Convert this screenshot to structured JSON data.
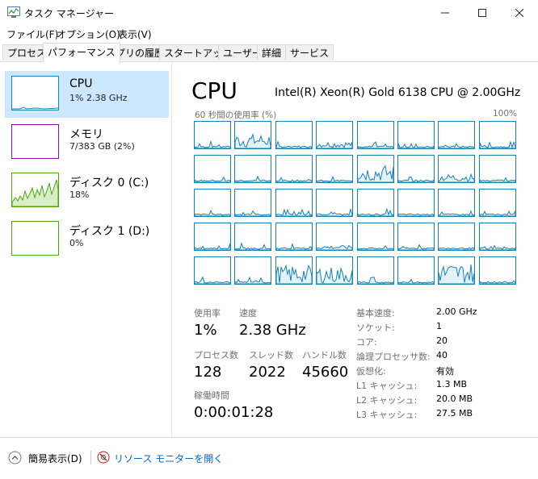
{
  "window": {
    "title": "タスク マネージャー"
  },
  "menu": [
    "ファイル(F)",
    "オプション(O)",
    "表示(V)"
  ],
  "tabs": [
    {
      "label": "プロセス"
    },
    {
      "label": "パフォーマンス",
      "active": true
    },
    {
      "label": "アプリの履歴"
    },
    {
      "label": "スタートアップ"
    },
    {
      "label": "ユーザー"
    },
    {
      "label": "詳細"
    },
    {
      "label": "サービス"
    }
  ],
  "resources": [
    {
      "name": "CPU",
      "detail": "1%  2.38 GHz"
    },
    {
      "name": "メモリ",
      "detail": "7/383 GB (2%)"
    },
    {
      "name": "ディスク 0 (C:)",
      "detail": "18%"
    },
    {
      "name": "ディスク 1 (D:)",
      "detail": "0%"
    }
  ],
  "cpu": {
    "title": "CPU",
    "model": "Intel(R) Xeon(R) Gold 6138 CPU @ 2.00GHz",
    "graph_label": "60 秒間の使用率 (%)",
    "graph_max": "100%",
    "stats": {
      "usage_label": "使用率",
      "usage": "1%",
      "speed_label": "速度",
      "speed": "2.38 GHz",
      "processes_label": "プロセス数",
      "processes": "128",
      "threads_label": "スレッド数",
      "threads": "2022",
      "handles_label": "ハンドル数",
      "handles": "45660",
      "uptime_label": "稼働時間",
      "uptime": "0:00:01:28"
    },
    "specs": [
      {
        "label": "基本速度:",
        "value": "2.00 GHz"
      },
      {
        "label": "ソケット:",
        "value": "1"
      },
      {
        "label": "コア:",
        "value": "20"
      },
      {
        "label": "論理プロセッサ数:",
        "value": "40"
      },
      {
        "label": "仮想化:",
        "value": "有効"
      },
      {
        "label": "L1 キャッシュ:",
        "value": "1.3 MB"
      },
      {
        "label": "L2 キャッシュ:",
        "value": "20.0 MB"
      },
      {
        "label": "L3 キャッシュ:",
        "value": "27.5 MB"
      }
    ]
  },
  "footer": {
    "fewer_details": "簡易表示(D)",
    "resource_monitor": "リソース モニターを開く"
  },
  "colors": {
    "cpu": "#1782b8",
    "memory": "#8b12ae",
    "disk": "#4da60c",
    "selected": "#cce8ff",
    "link": "#0066cc"
  }
}
